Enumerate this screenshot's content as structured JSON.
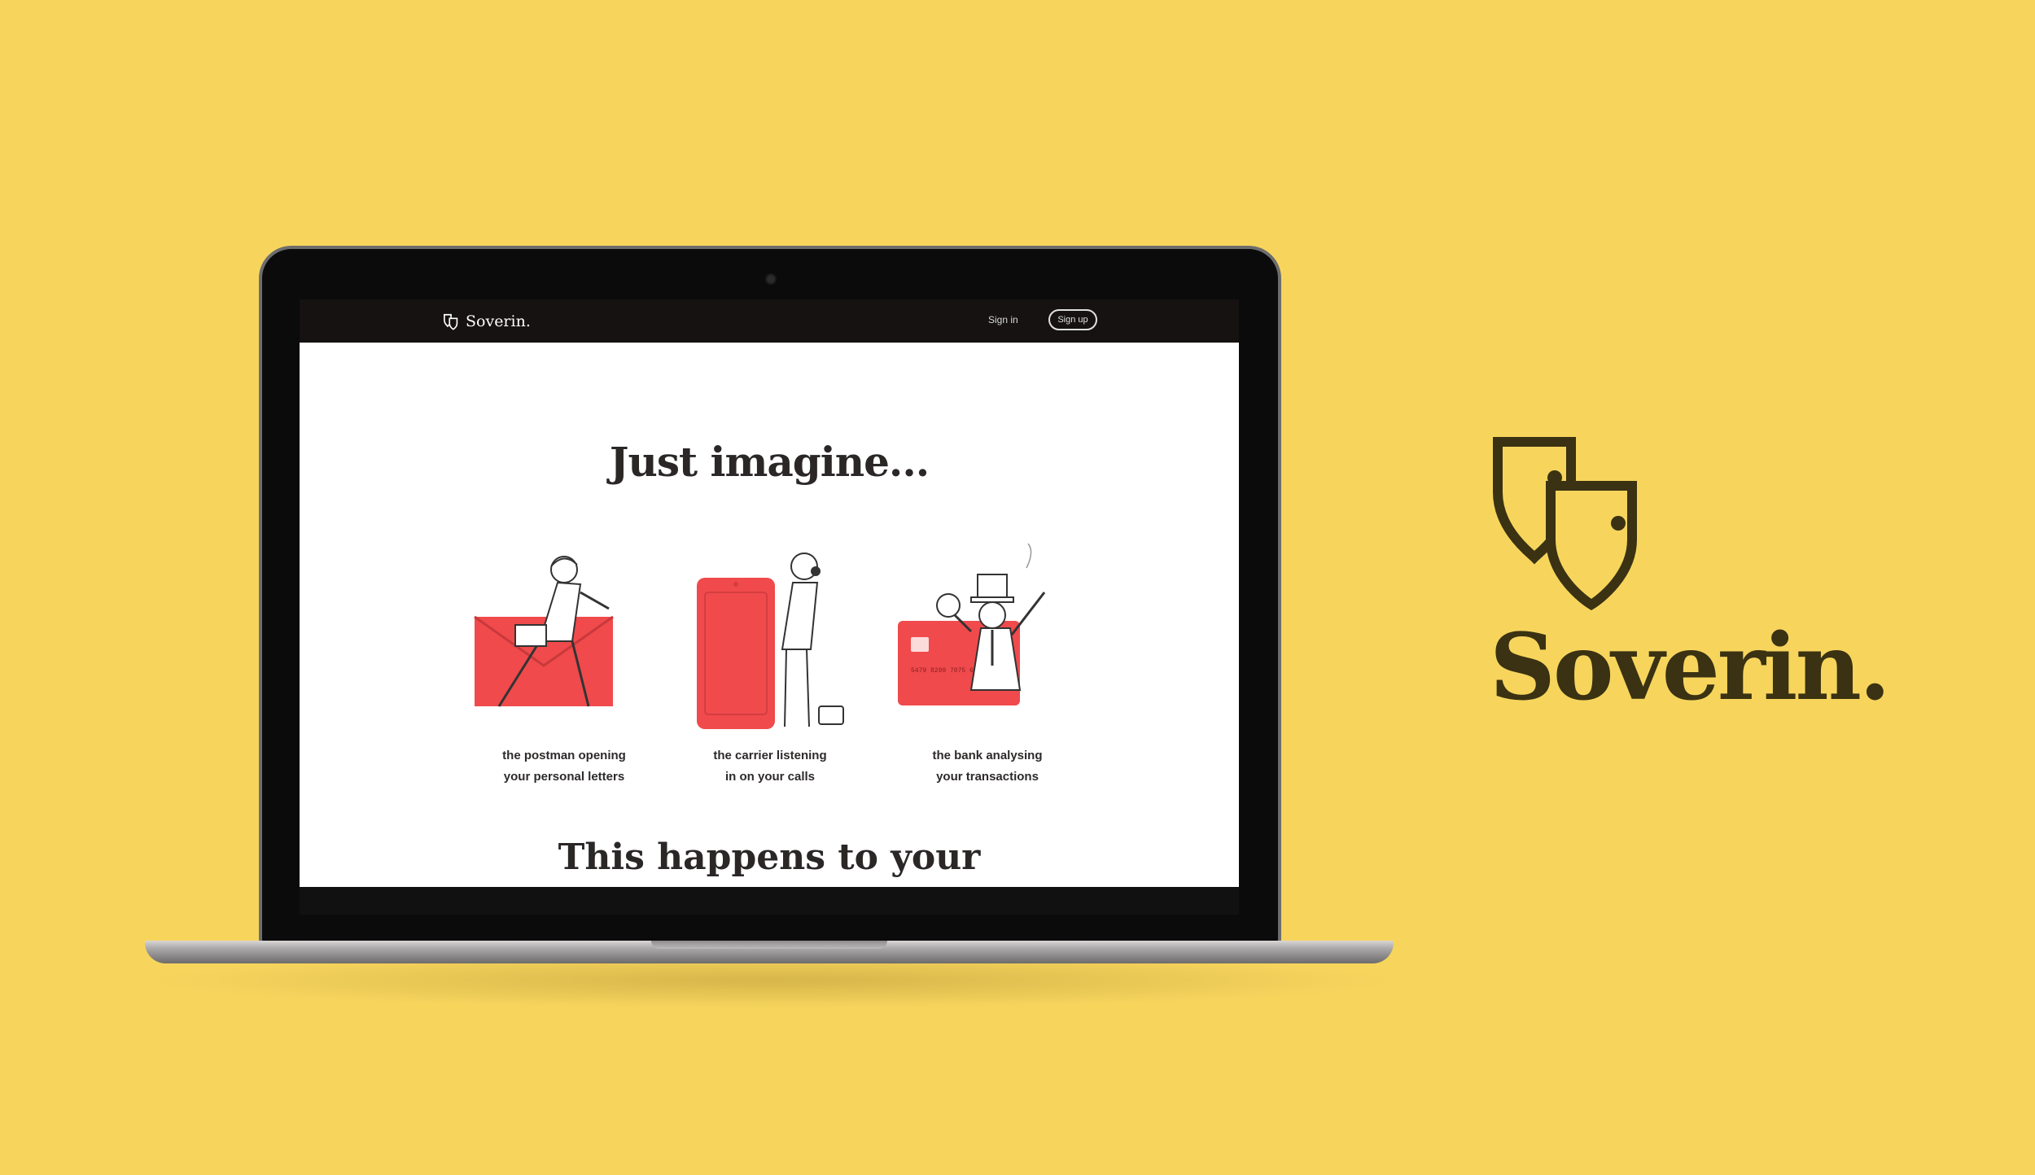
{
  "site": {
    "brand": "Soverin.",
    "nav": {
      "signin": "Sign in",
      "signup": "Sign up"
    },
    "hero_title": "Just imagine...",
    "features": [
      {
        "line1": "the postman opening",
        "line2": "your personal letters",
        "icon": "postman-envelope-illustration"
      },
      {
        "line1": "the carrier listening",
        "line2": "in on your calls",
        "icon": "phone-listener-illustration"
      },
      {
        "line1": "the bank analysing",
        "line2": "your transactions",
        "icon": "banker-card-illustration"
      }
    ],
    "next_heading": "This happens to your"
  },
  "brand_mark": {
    "name": "Soverin.",
    "color": "#3a3212"
  },
  "colors": {
    "background": "#f7d55d",
    "accent_red": "#f04a4c",
    "nav_dark": "#151211"
  }
}
